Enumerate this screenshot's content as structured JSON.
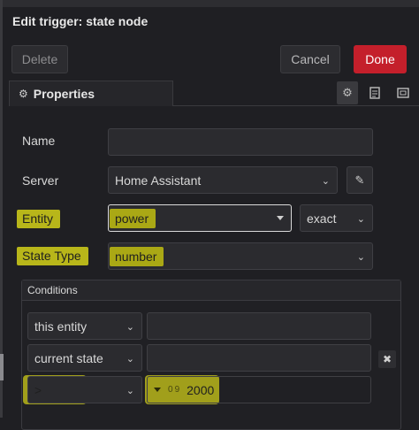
{
  "dialog": {
    "title": "Edit trigger: state node",
    "delete_label": "Delete",
    "cancel_label": "Cancel",
    "done_label": "Done"
  },
  "tabs": {
    "properties_label": "Properties",
    "icons": [
      "gear-icon",
      "description-icon",
      "appearance-icon"
    ]
  },
  "form": {
    "name_label": "Name",
    "name_value": "",
    "server_label": "Server",
    "server_value": "Home Assistant",
    "entity_label": "Entity",
    "entity_value": "power",
    "entity_match": "exact",
    "state_type_label": "State Type",
    "state_type_value": "number"
  },
  "conditions": {
    "header": "Conditions",
    "rows": [
      {
        "subject": "this entity",
        "value": ""
      },
      {
        "subject": "current state",
        "value": ""
      },
      {
        "subject": ">",
        "value": "2000",
        "value_type": "0 9"
      }
    ]
  },
  "colors": {
    "accent_done": "#c41f2b",
    "highlight": "#b8b61a"
  }
}
